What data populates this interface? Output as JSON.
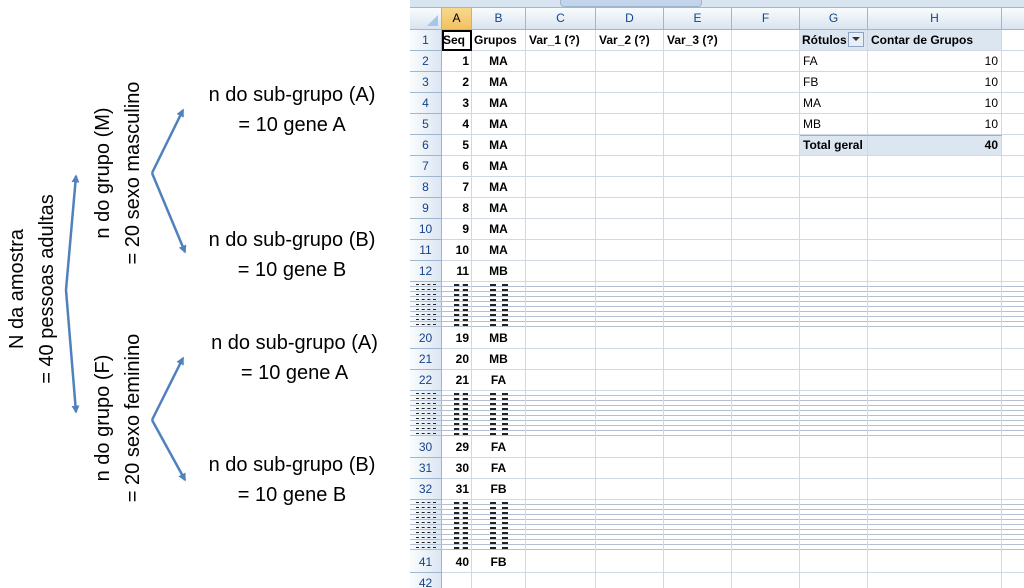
{
  "diagram": {
    "root": {
      "line1": "N da amostra",
      "line2": "= 40 pessoas adultas"
    },
    "group_m": {
      "line1": "n do grupo (M)",
      "line2": "= 20 sexo masculino"
    },
    "group_f": {
      "line1": "n do grupo (F)",
      "line2": "= 20 sexo feminino"
    },
    "m_sub_a": {
      "line1": "n do sub-grupo (A)",
      "line2": "= 10 gene A"
    },
    "m_sub_b": {
      "line1": "n do sub-grupo (B)",
      "line2": "= 10 gene B"
    },
    "f_sub_a": {
      "line1": "n do sub-grupo  (A)",
      "line2": "= 10 gene A"
    },
    "f_sub_b": {
      "line1": "n do sub-grupo (B)",
      "line2": "= 10 gene B"
    },
    "arrow_color": "#4f81bd"
  },
  "spreadsheet": {
    "columns": [
      "A",
      "B",
      "C",
      "D",
      "E",
      "F",
      "G",
      "H"
    ],
    "header_row": {
      "num": "1",
      "a": "Seq",
      "b": "Grupos",
      "c": "Var_1 (?)",
      "d": "Var_2 (?)",
      "e": "Var_3 (?)",
      "g": "Rótulos",
      "h": "Contar de Grupos"
    },
    "rows": [
      {
        "num": "2",
        "seq": "1",
        "grupo": "MA"
      },
      {
        "num": "3",
        "seq": "2",
        "grupo": "MA"
      },
      {
        "num": "4",
        "seq": "3",
        "grupo": "MA"
      },
      {
        "num": "5",
        "seq": "4",
        "grupo": "MA"
      },
      {
        "num": "6",
        "seq": "5",
        "grupo": "MA"
      },
      {
        "num": "7",
        "seq": "6",
        "grupo": "MA"
      },
      {
        "num": "8",
        "seq": "7",
        "grupo": "MA"
      },
      {
        "num": "9",
        "seq": "8",
        "grupo": "MA"
      },
      {
        "num": "10",
        "seq": "9",
        "grupo": "MA"
      },
      {
        "num": "11",
        "seq": "10",
        "grupo": "MA"
      },
      {
        "num": "12",
        "seq": "11",
        "grupo": "MB"
      },
      {
        "num": "20",
        "seq": "19",
        "grupo": "MB"
      },
      {
        "num": "21",
        "seq": "20",
        "grupo": "MB"
      },
      {
        "num": "22",
        "seq": "21",
        "grupo": "FA"
      },
      {
        "num": "30",
        "seq": "29",
        "grupo": "FA"
      },
      {
        "num": "31",
        "seq": "30",
        "grupo": "FA"
      },
      {
        "num": "32",
        "seq": "31",
        "grupo": "FB"
      },
      {
        "num": "41",
        "seq": "40",
        "grupo": "FB"
      },
      {
        "num": "42",
        "seq": "",
        "grupo": ""
      }
    ],
    "pivot": [
      {
        "label": "FA",
        "value": "10"
      },
      {
        "label": "FB",
        "value": "10"
      },
      {
        "label": "MA",
        "value": "10"
      },
      {
        "label": "MB",
        "value": "10"
      },
      {
        "label": "Total geral",
        "value": "40"
      }
    ]
  }
}
